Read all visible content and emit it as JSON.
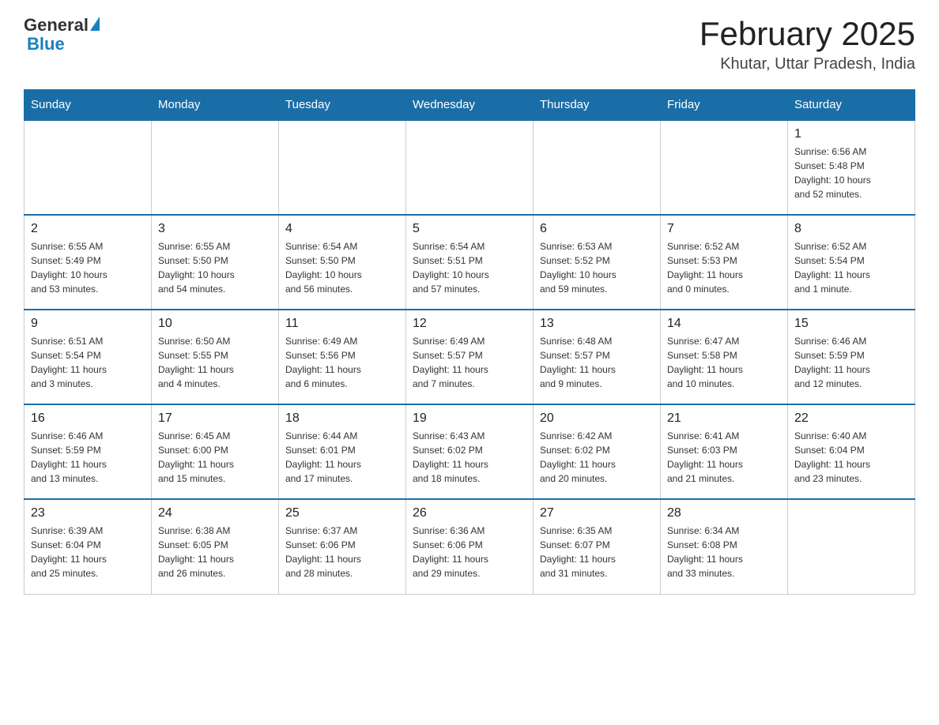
{
  "header": {
    "logo_general": "General",
    "logo_blue": "Blue",
    "month_title": "February 2025",
    "location": "Khutar, Uttar Pradesh, India"
  },
  "weekdays": [
    "Sunday",
    "Monday",
    "Tuesday",
    "Wednesday",
    "Thursday",
    "Friday",
    "Saturday"
  ],
  "weeks": [
    [
      {
        "day": "",
        "info": ""
      },
      {
        "day": "",
        "info": ""
      },
      {
        "day": "",
        "info": ""
      },
      {
        "day": "",
        "info": ""
      },
      {
        "day": "",
        "info": ""
      },
      {
        "day": "",
        "info": ""
      },
      {
        "day": "1",
        "info": "Sunrise: 6:56 AM\nSunset: 5:48 PM\nDaylight: 10 hours\nand 52 minutes."
      }
    ],
    [
      {
        "day": "2",
        "info": "Sunrise: 6:55 AM\nSunset: 5:49 PM\nDaylight: 10 hours\nand 53 minutes."
      },
      {
        "day": "3",
        "info": "Sunrise: 6:55 AM\nSunset: 5:50 PM\nDaylight: 10 hours\nand 54 minutes."
      },
      {
        "day": "4",
        "info": "Sunrise: 6:54 AM\nSunset: 5:50 PM\nDaylight: 10 hours\nand 56 minutes."
      },
      {
        "day": "5",
        "info": "Sunrise: 6:54 AM\nSunset: 5:51 PM\nDaylight: 10 hours\nand 57 minutes."
      },
      {
        "day": "6",
        "info": "Sunrise: 6:53 AM\nSunset: 5:52 PM\nDaylight: 10 hours\nand 59 minutes."
      },
      {
        "day": "7",
        "info": "Sunrise: 6:52 AM\nSunset: 5:53 PM\nDaylight: 11 hours\nand 0 minutes."
      },
      {
        "day": "8",
        "info": "Sunrise: 6:52 AM\nSunset: 5:54 PM\nDaylight: 11 hours\nand 1 minute."
      }
    ],
    [
      {
        "day": "9",
        "info": "Sunrise: 6:51 AM\nSunset: 5:54 PM\nDaylight: 11 hours\nand 3 minutes."
      },
      {
        "day": "10",
        "info": "Sunrise: 6:50 AM\nSunset: 5:55 PM\nDaylight: 11 hours\nand 4 minutes."
      },
      {
        "day": "11",
        "info": "Sunrise: 6:49 AM\nSunset: 5:56 PM\nDaylight: 11 hours\nand 6 minutes."
      },
      {
        "day": "12",
        "info": "Sunrise: 6:49 AM\nSunset: 5:57 PM\nDaylight: 11 hours\nand 7 minutes."
      },
      {
        "day": "13",
        "info": "Sunrise: 6:48 AM\nSunset: 5:57 PM\nDaylight: 11 hours\nand 9 minutes."
      },
      {
        "day": "14",
        "info": "Sunrise: 6:47 AM\nSunset: 5:58 PM\nDaylight: 11 hours\nand 10 minutes."
      },
      {
        "day": "15",
        "info": "Sunrise: 6:46 AM\nSunset: 5:59 PM\nDaylight: 11 hours\nand 12 minutes."
      }
    ],
    [
      {
        "day": "16",
        "info": "Sunrise: 6:46 AM\nSunset: 5:59 PM\nDaylight: 11 hours\nand 13 minutes."
      },
      {
        "day": "17",
        "info": "Sunrise: 6:45 AM\nSunset: 6:00 PM\nDaylight: 11 hours\nand 15 minutes."
      },
      {
        "day": "18",
        "info": "Sunrise: 6:44 AM\nSunset: 6:01 PM\nDaylight: 11 hours\nand 17 minutes."
      },
      {
        "day": "19",
        "info": "Sunrise: 6:43 AM\nSunset: 6:02 PM\nDaylight: 11 hours\nand 18 minutes."
      },
      {
        "day": "20",
        "info": "Sunrise: 6:42 AM\nSunset: 6:02 PM\nDaylight: 11 hours\nand 20 minutes."
      },
      {
        "day": "21",
        "info": "Sunrise: 6:41 AM\nSunset: 6:03 PM\nDaylight: 11 hours\nand 21 minutes."
      },
      {
        "day": "22",
        "info": "Sunrise: 6:40 AM\nSunset: 6:04 PM\nDaylight: 11 hours\nand 23 minutes."
      }
    ],
    [
      {
        "day": "23",
        "info": "Sunrise: 6:39 AM\nSunset: 6:04 PM\nDaylight: 11 hours\nand 25 minutes."
      },
      {
        "day": "24",
        "info": "Sunrise: 6:38 AM\nSunset: 6:05 PM\nDaylight: 11 hours\nand 26 minutes."
      },
      {
        "day": "25",
        "info": "Sunrise: 6:37 AM\nSunset: 6:06 PM\nDaylight: 11 hours\nand 28 minutes."
      },
      {
        "day": "26",
        "info": "Sunrise: 6:36 AM\nSunset: 6:06 PM\nDaylight: 11 hours\nand 29 minutes."
      },
      {
        "day": "27",
        "info": "Sunrise: 6:35 AM\nSunset: 6:07 PM\nDaylight: 11 hours\nand 31 minutes."
      },
      {
        "day": "28",
        "info": "Sunrise: 6:34 AM\nSunset: 6:08 PM\nDaylight: 11 hours\nand 33 minutes."
      },
      {
        "day": "",
        "info": ""
      }
    ]
  ]
}
